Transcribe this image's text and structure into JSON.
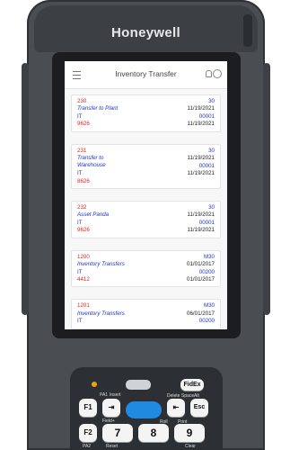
{
  "device": {
    "brand": "Honeywell"
  },
  "app": {
    "title": "Inventory Transfer"
  },
  "cards": [
    {
      "id": "230",
      "qty": "30",
      "type": "Transfer to Plant",
      "date1": "11/19/2021",
      "cat": "IT",
      "code": "00001",
      "ref": "9626",
      "date2": "11/19/2021"
    },
    {
      "id": "231",
      "qty": "30",
      "type": "Transfer to Warehouse",
      "date1": "11/19/2021",
      "cat": "IT",
      "code": "00001",
      "ref": "8626",
      "date2": "11/19/2021"
    },
    {
      "id": "232",
      "qty": "30",
      "type": "Asset Panda",
      "date1": "11/19/2021",
      "cat": "IT",
      "code": "00001",
      "ref": "9626",
      "date2": "11/19/2021"
    },
    {
      "id": "1200",
      "qty": "M30",
      "type": "Inventory Transfers",
      "date1": "01/01/2017",
      "cat": "IT",
      "code": "00200",
      "ref": "4412",
      "date2": "01/01/2017"
    },
    {
      "id": "1201",
      "qty": "M30",
      "type": "Inventory Transfers",
      "date1": "06/01/2017",
      "cat": "IT",
      "code": "00200",
      "ref": "",
      "date2": ""
    }
  ],
  "keypad": {
    "fidex": "FidEx",
    "pa1": "PA1",
    "insert": "Insert",
    "f1": "F1",
    "field_plus": "Field+",
    "f2": "F2",
    "pa2": "PA2",
    "reset": "Reset",
    "delete": "Delete",
    "space": "Space",
    "alt": "Alt",
    "roll": "Roll",
    "print": "Print",
    "esc": "Esc",
    "k7": "7",
    "k8": "8",
    "k9": "9",
    "clear": "Clear"
  }
}
